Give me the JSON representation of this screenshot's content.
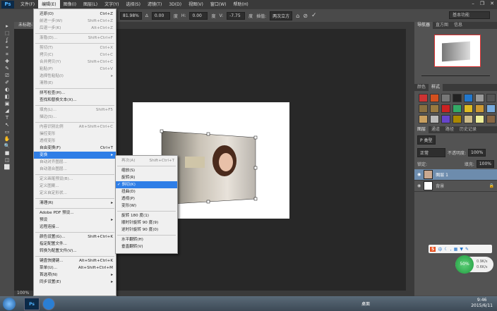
{
  "menubar": {
    "logo": "Ps",
    "items": [
      "文件(F)",
      "编辑(E)",
      "图像(I)",
      "图层(L)",
      "文字(Y)",
      "选择(S)",
      "滤镜(T)",
      "3D(D)",
      "视图(V)",
      "窗口(W)",
      "帮助(H)"
    ]
  },
  "window_controls": [
    "–",
    "❐",
    "✕"
  ],
  "options": {
    "w_label": "W:",
    "w_value": "81.98%",
    "angle_value": "0.00",
    "angle_unit": "度",
    "h_label": "H:",
    "h_value": "0.00",
    "h_unit": "度",
    "v_label": "V:",
    "v_value": "-7.75",
    "v_unit": "度",
    "interp_label": "插值:",
    "interp_value": "两次立方",
    "workspace": "基本功能"
  },
  "tab": {
    "title": "未标题-1 @ 100% (图层 1, RGB/8)",
    "close": "×"
  },
  "status": {
    "zoom": "100%"
  },
  "edit_menu": [
    {
      "label": "还原(O)",
      "shortcut": "Ctrl+Z"
    },
    {
      "label": "前进一步(W)",
      "shortcut": "Shift+Ctrl+Z",
      "disabled": true
    },
    {
      "label": "后退一步(K)",
      "shortcut": "Alt+Ctrl+Z",
      "disabled": true
    },
    {
      "sep": true
    },
    {
      "label": "渐隐(D)...",
      "shortcut": "Shift+Ctrl+F",
      "disabled": true
    },
    {
      "sep": true
    },
    {
      "label": "剪切(T)",
      "shortcut": "Ctrl+X",
      "disabled": true
    },
    {
      "label": "拷贝(C)",
      "shortcut": "Ctrl+C",
      "disabled": true
    },
    {
      "label": "合并拷贝(Y)",
      "shortcut": "Shift+Ctrl+C",
      "disabled": true
    },
    {
      "label": "粘贴(P)",
      "shortcut": "Ctrl+V",
      "disabled": true
    },
    {
      "label": "选择性粘贴(I)",
      "shortcut": "▸",
      "disabled": true
    },
    {
      "label": "清除(E)",
      "shortcut": "",
      "disabled": true
    },
    {
      "sep": true
    },
    {
      "label": "拼写检查(H)...",
      "shortcut": ""
    },
    {
      "label": "查找和替换文本(X)...",
      "shortcut": ""
    },
    {
      "sep": true
    },
    {
      "label": "填充(L)...",
      "shortcut": "Shift+F5",
      "disabled": true
    },
    {
      "label": "描边(S)...",
      "shortcut": "",
      "disabled": true
    },
    {
      "sep": true
    },
    {
      "label": "内容识别比例",
      "shortcut": "Alt+Shift+Ctrl+C",
      "disabled": true
    },
    {
      "label": "操控变形",
      "shortcut": "",
      "disabled": true
    },
    {
      "label": "透视变形",
      "shortcut": "",
      "disabled": true
    },
    {
      "label": "自由变换(F)",
      "shortcut": "Ctrl+T"
    },
    {
      "label": "变换",
      "shortcut": "▸",
      "highlight": true
    },
    {
      "label": "自动对齐图层...",
      "shortcut": "",
      "disabled": true
    },
    {
      "label": "自动混合图层...",
      "shortcut": "",
      "disabled": true
    },
    {
      "sep": true
    },
    {
      "label": "定义画笔预设(B)...",
      "shortcut": "",
      "disabled": true
    },
    {
      "label": "定义图案...",
      "shortcut": "",
      "disabled": true
    },
    {
      "label": "定义自定形状...",
      "shortcut": "",
      "disabled": true
    },
    {
      "sep": true
    },
    {
      "label": "清理(R)",
      "shortcut": "▸"
    },
    {
      "sep": true
    },
    {
      "label": "Adobe PDF 预设...",
      "shortcut": ""
    },
    {
      "label": "预设",
      "shortcut": "▸"
    },
    {
      "label": "远程连接...",
      "shortcut": ""
    },
    {
      "sep": true
    },
    {
      "label": "颜色设置(G)...",
      "shortcut": "Shift+Ctrl+K"
    },
    {
      "label": "指定配置文件...",
      "shortcut": ""
    },
    {
      "label": "转换为配置文件(V)...",
      "shortcut": ""
    },
    {
      "sep": true
    },
    {
      "label": "键盘快捷键...",
      "shortcut": "Alt+Shift+Ctrl+K"
    },
    {
      "label": "菜单(U)...",
      "shortcut": "Alt+Shift+Ctrl+M"
    },
    {
      "label": "首选项(N)",
      "shortcut": "▸"
    },
    {
      "label": "同步设置(E)",
      "shortcut": "▸"
    }
  ],
  "transform_menu": [
    {
      "label": "再次(A)",
      "shortcut": "Shift+Ctrl+T",
      "disabled": true
    },
    {
      "sep": true
    },
    {
      "label": "缩放(S)",
      "shortcut": ""
    },
    {
      "label": "旋转(R)",
      "shortcut": ""
    },
    {
      "label": "斜切(K)",
      "shortcut": "",
      "highlight": true,
      "checked": true
    },
    {
      "label": "扭曲(D)",
      "shortcut": ""
    },
    {
      "label": "透视(P)",
      "shortcut": ""
    },
    {
      "label": "变形(W)",
      "shortcut": ""
    },
    {
      "sep": true
    },
    {
      "label": "旋转 180 度(1)",
      "shortcut": ""
    },
    {
      "label": "顺时针旋转 90 度(9)",
      "shortcut": ""
    },
    {
      "label": "逆时针旋转 90 度(0)",
      "shortcut": ""
    },
    {
      "sep": true
    },
    {
      "label": "水平翻转(H)",
      "shortcut": ""
    },
    {
      "label": "垂直翻转(V)",
      "shortcut": ""
    }
  ],
  "navigator": {
    "tabs": [
      "导航器",
      "直方图",
      "信息"
    ]
  },
  "styles": {
    "tabs": [
      "颜色",
      "样式"
    ]
  },
  "layers": {
    "tabs": [
      "图层",
      "通道",
      "路径",
      "历史记录"
    ],
    "filter": "P 类型",
    "blend": "正常",
    "opacity_label": "不透明度:",
    "opacity": "100%",
    "lock_label": "锁定:",
    "fill_label": "填充:",
    "fill": "100%",
    "items": [
      {
        "name": "图层 1",
        "selected": true
      },
      {
        "name": "背景",
        "locked": true
      }
    ]
  },
  "taskbar": {
    "desktop": "桌面",
    "ps": "Ps",
    "time": "9:46",
    "date": "2015/6/11"
  },
  "ime": {
    "logo": "S",
    "mode": "中"
  },
  "speed": {
    "percent": "50%",
    "up": "0.9K/s",
    "down": "0.6K/s"
  },
  "colors": {
    "menu_highlight": "#2f7ee6",
    "selected_layer": "#6d8cad"
  }
}
